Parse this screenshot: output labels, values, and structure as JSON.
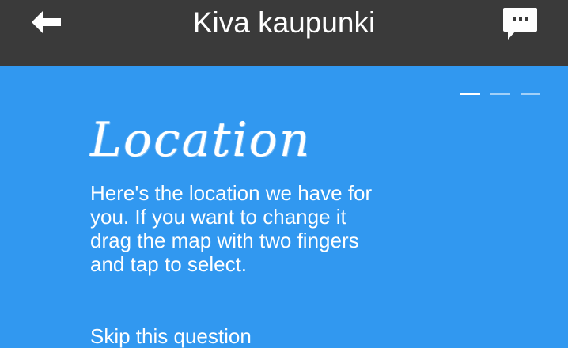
{
  "header": {
    "title": "Kiva kaupunki",
    "back_icon": "arrow-left-icon",
    "chat_icon": "chat-bubble-icon",
    "background_color": "#3a3a3a"
  },
  "pager": {
    "total_pages": 3,
    "active_page": 1
  },
  "main": {
    "background_color": "#3198f0",
    "heading": "Location",
    "body": "Here's the location we have for you. If you want to change it drag the map with two fingers and tap to select.",
    "skip_label": "Skip this question"
  }
}
